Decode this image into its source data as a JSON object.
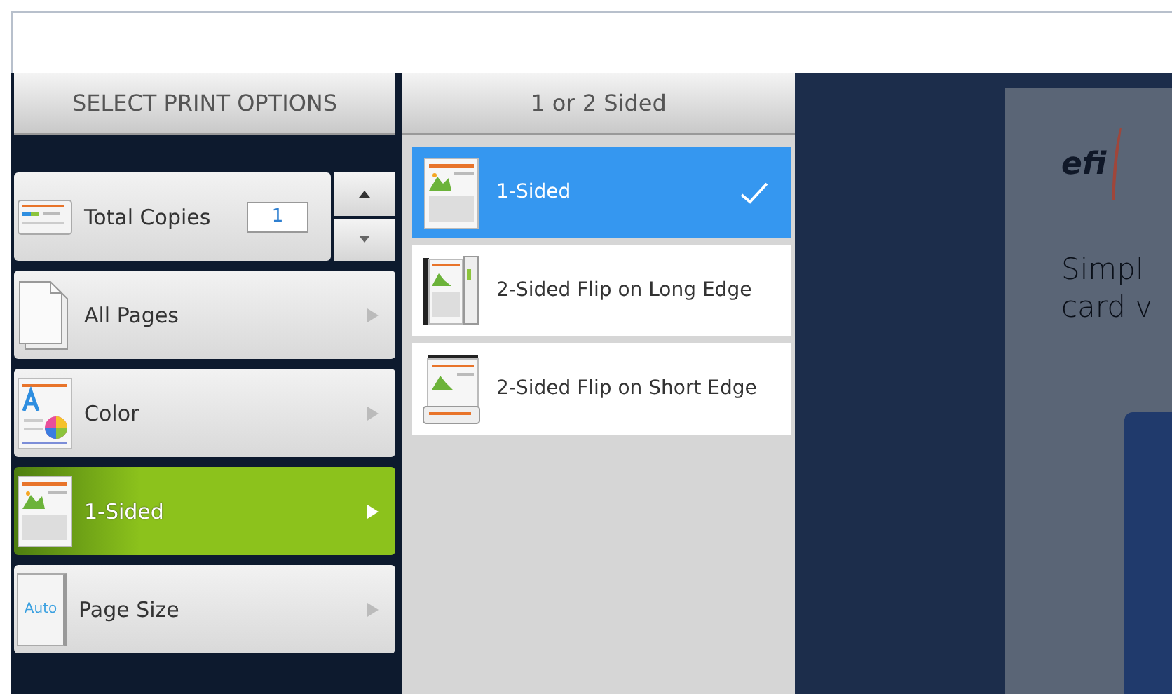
{
  "options_panel": {
    "title": "SELECT PRINT OPTIONS",
    "items": [
      {
        "kind": "copies",
        "label": "Total Copies",
        "value": "1"
      },
      {
        "kind": "nav",
        "label": "All Pages",
        "selected": false
      },
      {
        "kind": "nav",
        "label": "Color",
        "selected": false
      },
      {
        "kind": "nav",
        "label": "1-Sided",
        "selected": true
      },
      {
        "kind": "nav",
        "icon_text": "Auto",
        "label": "Page Size",
        "selected": false
      }
    ]
  },
  "choice_panel": {
    "title": "1 or 2 Sided",
    "items": [
      {
        "label": "1-Sided",
        "selected": true
      },
      {
        "label": "2-Sided Flip on Long Edge",
        "selected": false
      },
      {
        "label": "2-Sided Flip on Short Edge",
        "selected": false
      }
    ]
  },
  "preview": {
    "logo": "efi",
    "heading_lines": [
      "Simpl",
      "card v"
    ]
  }
}
